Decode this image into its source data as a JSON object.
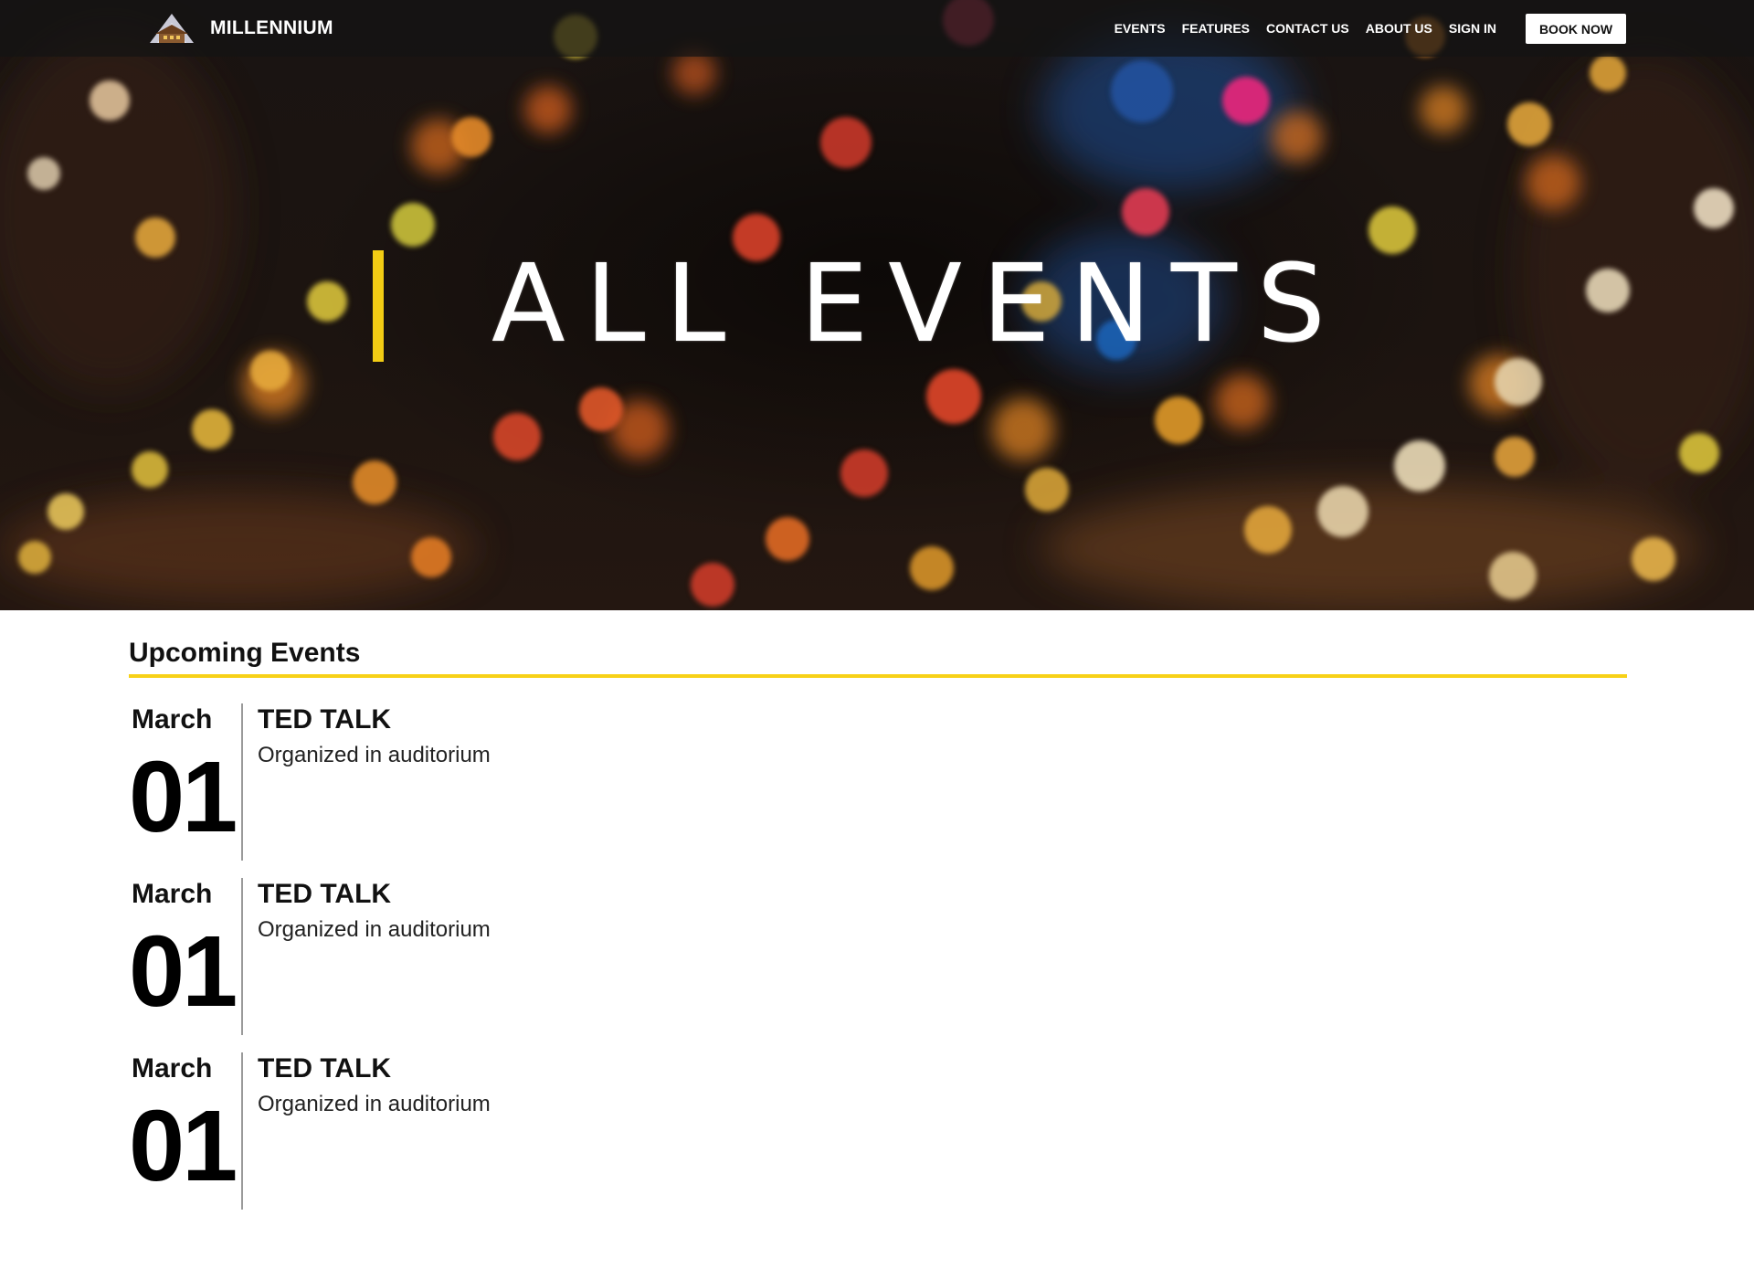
{
  "nav": {
    "brand": "MILLENNIUM",
    "links": [
      "EVENTS",
      "FEATURES",
      "CONTACT US",
      "ABOUT US",
      "SIGN IN"
    ],
    "cta": "BOOK NOW"
  },
  "hero": {
    "title": "ALL EVENTS",
    "accent_color": "#f2cc14"
  },
  "events_section": {
    "heading": "Upcoming Events",
    "rule_color": "#f7d117",
    "events": [
      {
        "month": "March",
        "day": "01",
        "title": "TED TALK",
        "description": "Organized in auditorium"
      },
      {
        "month": "March",
        "day": "01",
        "title": "TED TALK",
        "description": "Organized in auditorium"
      },
      {
        "month": "March",
        "day": "01",
        "title": "TED TALK",
        "description": "Organized in auditorium"
      }
    ]
  },
  "icons": {
    "brand_logo": "mountain-lodge-logo-icon"
  }
}
